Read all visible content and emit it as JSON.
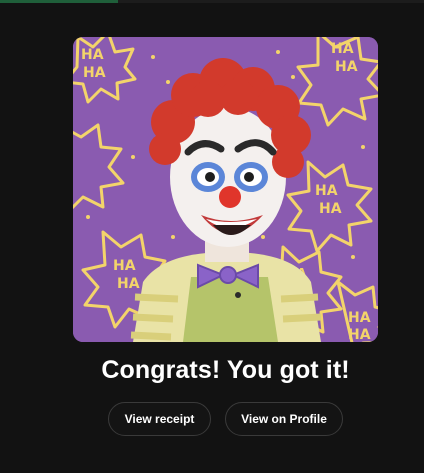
{
  "result": {
    "headline": "Congrats! You got it!",
    "view_receipt_label": "View receipt",
    "view_profile_label": "View on Profile"
  },
  "artwork": {
    "background_text": [
      "HA",
      "HA",
      "HA",
      "HA",
      "HA",
      "HA",
      "HA",
      "HA",
      "HA",
      "HA",
      "HA",
      "HA"
    ]
  },
  "colors": {
    "page_background": "#121212",
    "art_background": "#8a5bb0",
    "burst_yellow": "#f3d46a",
    "hair_red": "#d23a2c",
    "button_border": "#3a3a3a",
    "text_white": "#ffffff"
  }
}
